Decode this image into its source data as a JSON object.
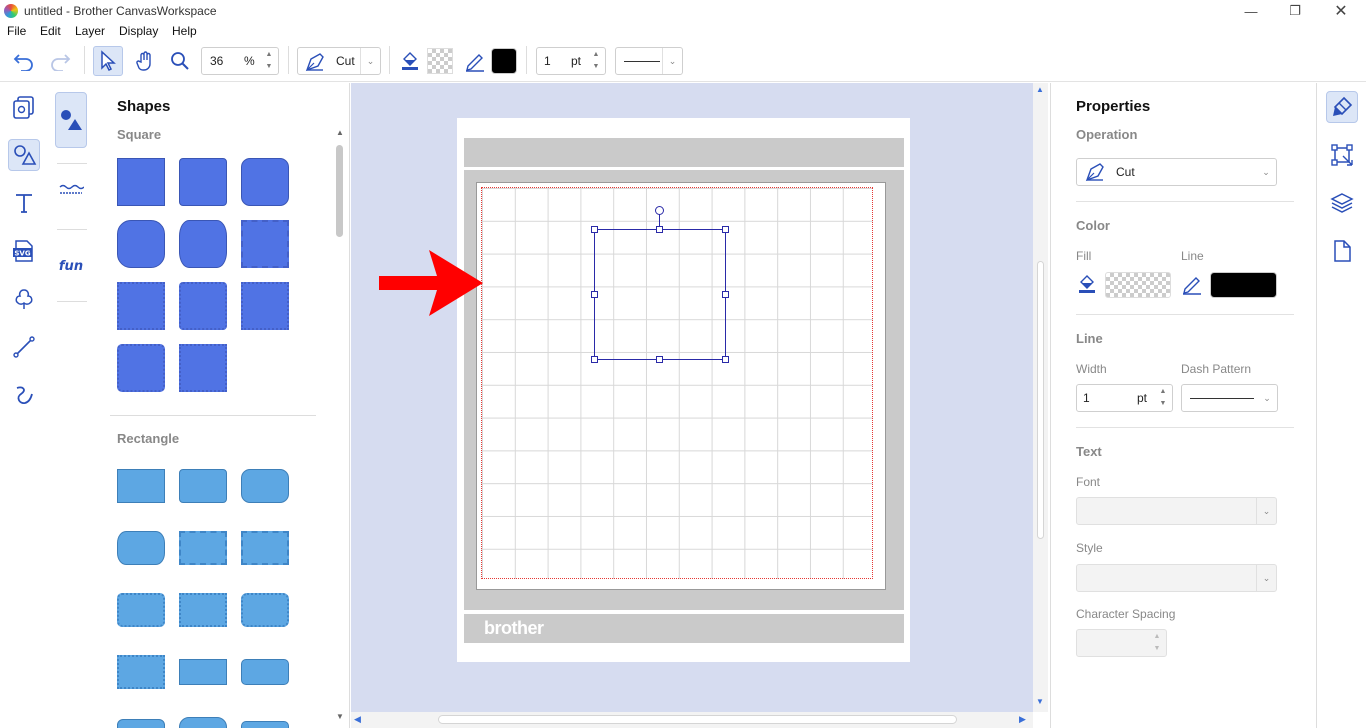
{
  "window": {
    "title": "untitled - Brother CanvasWorkspace",
    "minimize_icon": "minimize-icon",
    "restore_icon": "restore-icon",
    "close_icon": "close-icon"
  },
  "menu": [
    "File",
    "Edit",
    "Layer",
    "Display",
    "Help"
  ],
  "toolbar": {
    "zoom_value": "36",
    "zoom_unit": "%",
    "operation": "Cut",
    "line_width": "1",
    "line_unit": "pt",
    "stroke_color": "#000000"
  },
  "shapes_panel": {
    "title": "Shapes",
    "section_square": "Square",
    "section_rectangle": "Rectangle",
    "square_color": "#5073e4",
    "rectangle_color": "#5da7e3"
  },
  "canvas": {
    "brand": "brother",
    "background": "#d6dcf0",
    "annotation_arrow_color": "#ff0000"
  },
  "properties": {
    "title": "Properties",
    "operation_label": "Operation",
    "operation_value": "Cut",
    "color_label": "Color",
    "fill_label": "Fill",
    "line_label": "Line",
    "line_color": "#000000",
    "line_section": "Line",
    "width_label": "Width",
    "width_value": "1",
    "width_unit": "pt",
    "dash_label": "Dash Pattern",
    "text_section": "Text",
    "font_label": "Font",
    "style_label": "Style",
    "spacing_label": "Character Spacing"
  }
}
